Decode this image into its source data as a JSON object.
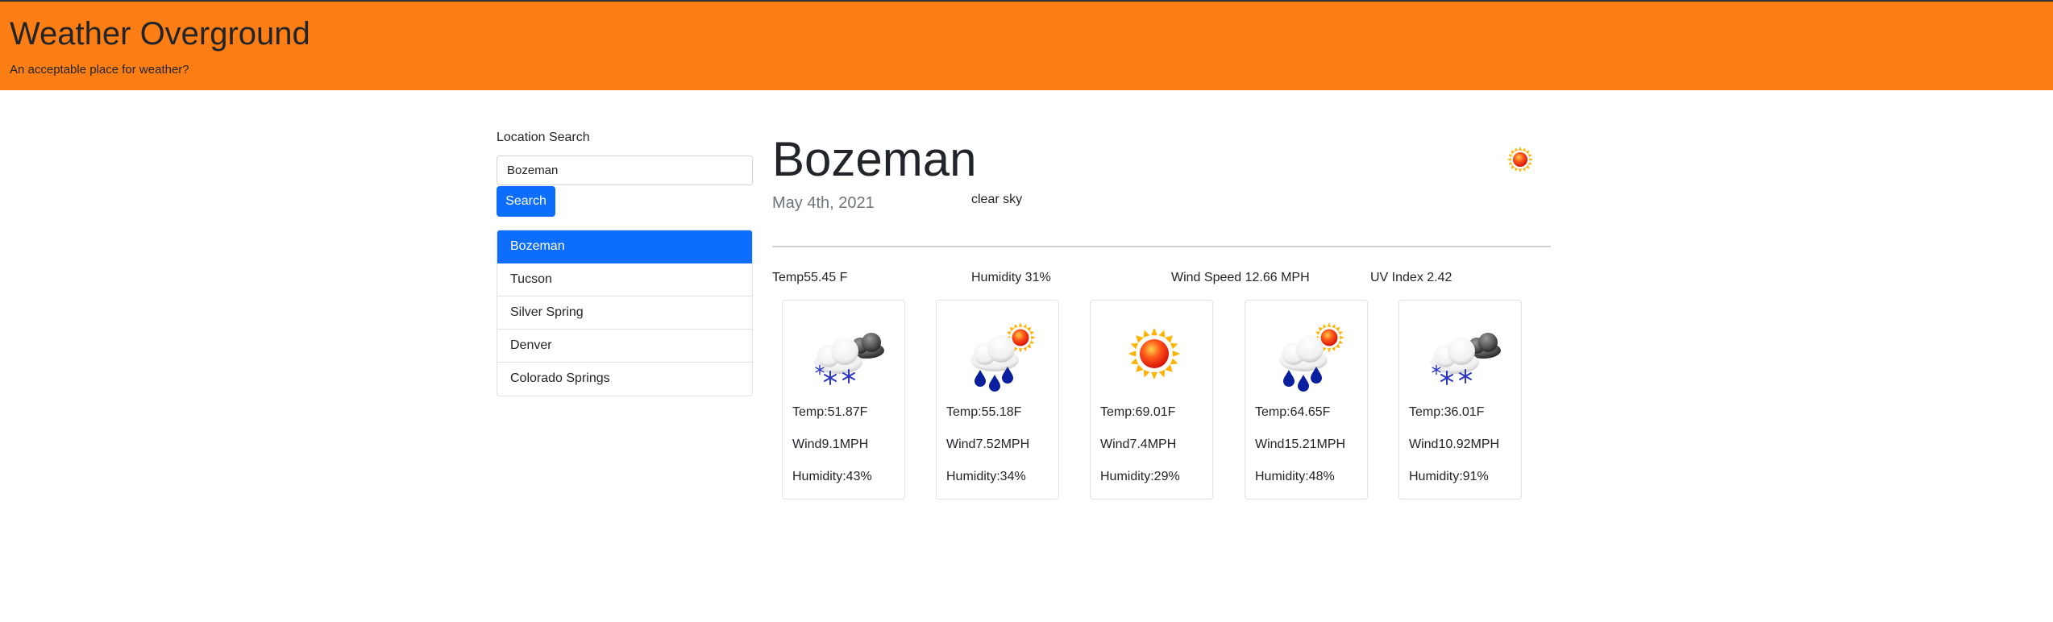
{
  "banner": {
    "title": "Weather Overground",
    "subtitle": "An acceptable place for weather?"
  },
  "sidebar": {
    "search_label": "Location Search",
    "search_value": "Bozeman",
    "search_button": "Search",
    "cities": [
      {
        "label": "Bozeman",
        "active": true
      },
      {
        "label": "Tucson",
        "active": false
      },
      {
        "label": "Silver Spring",
        "active": false
      },
      {
        "label": "Denver",
        "active": false
      },
      {
        "label": "Colorado Springs",
        "active": false
      }
    ]
  },
  "current": {
    "city": "Bozeman",
    "date": "May 4th, 2021",
    "description": "clear sky",
    "icon": "sun-icon",
    "temp": "Temp55.45 F",
    "humidity": "Humidity 31%",
    "wind": "Wind Speed 12.66 MPH",
    "uv": "UV Index 2.42"
  },
  "forecast": [
    {
      "icon": "snow-cloud-icon",
      "temp": "Temp:51.87F",
      "wind": "Wind9.1MPH",
      "humidity": "Humidity:43%"
    },
    {
      "icon": "rain-sun-cloud-icon",
      "temp": "Temp:55.18F",
      "wind": "Wind7.52MPH",
      "humidity": "Humidity:34%"
    },
    {
      "icon": "sun-icon",
      "temp": "Temp:69.01F",
      "wind": "Wind7.4MPH",
      "humidity": "Humidity:29%"
    },
    {
      "icon": "rain-sun-cloud-icon",
      "temp": "Temp:64.65F",
      "wind": "Wind15.21MPH",
      "humidity": "Humidity:48%"
    },
    {
      "icon": "snow-cloud-icon",
      "temp": "Temp:36.01F",
      "wind": "Wind10.92MPH",
      "humidity": "Humidity:91%"
    }
  ],
  "colors": {
    "banner": "#fd7e14",
    "primary": "#0d6efd",
    "sun_core": "#e8200a",
    "sun_rays": "#ffb300",
    "snowflake": "#2b36c8",
    "raindrop": "#0a1f9e"
  }
}
